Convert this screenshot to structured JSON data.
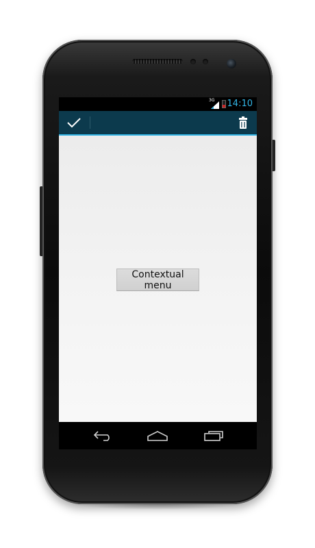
{
  "status_bar": {
    "network_label": "3G",
    "time": "14:10",
    "battery_level": 0.45
  },
  "action_mode": {
    "done_icon": "check-icon",
    "delete_icon": "trash-icon",
    "accent_color": "#33b5e5",
    "bar_color": "#0c3a4d"
  },
  "main": {
    "button_label": "Contextual menu"
  },
  "nav_bar": {
    "back_icon": "back-icon",
    "home_icon": "home-icon",
    "recent_icon": "recent-apps-icon"
  }
}
